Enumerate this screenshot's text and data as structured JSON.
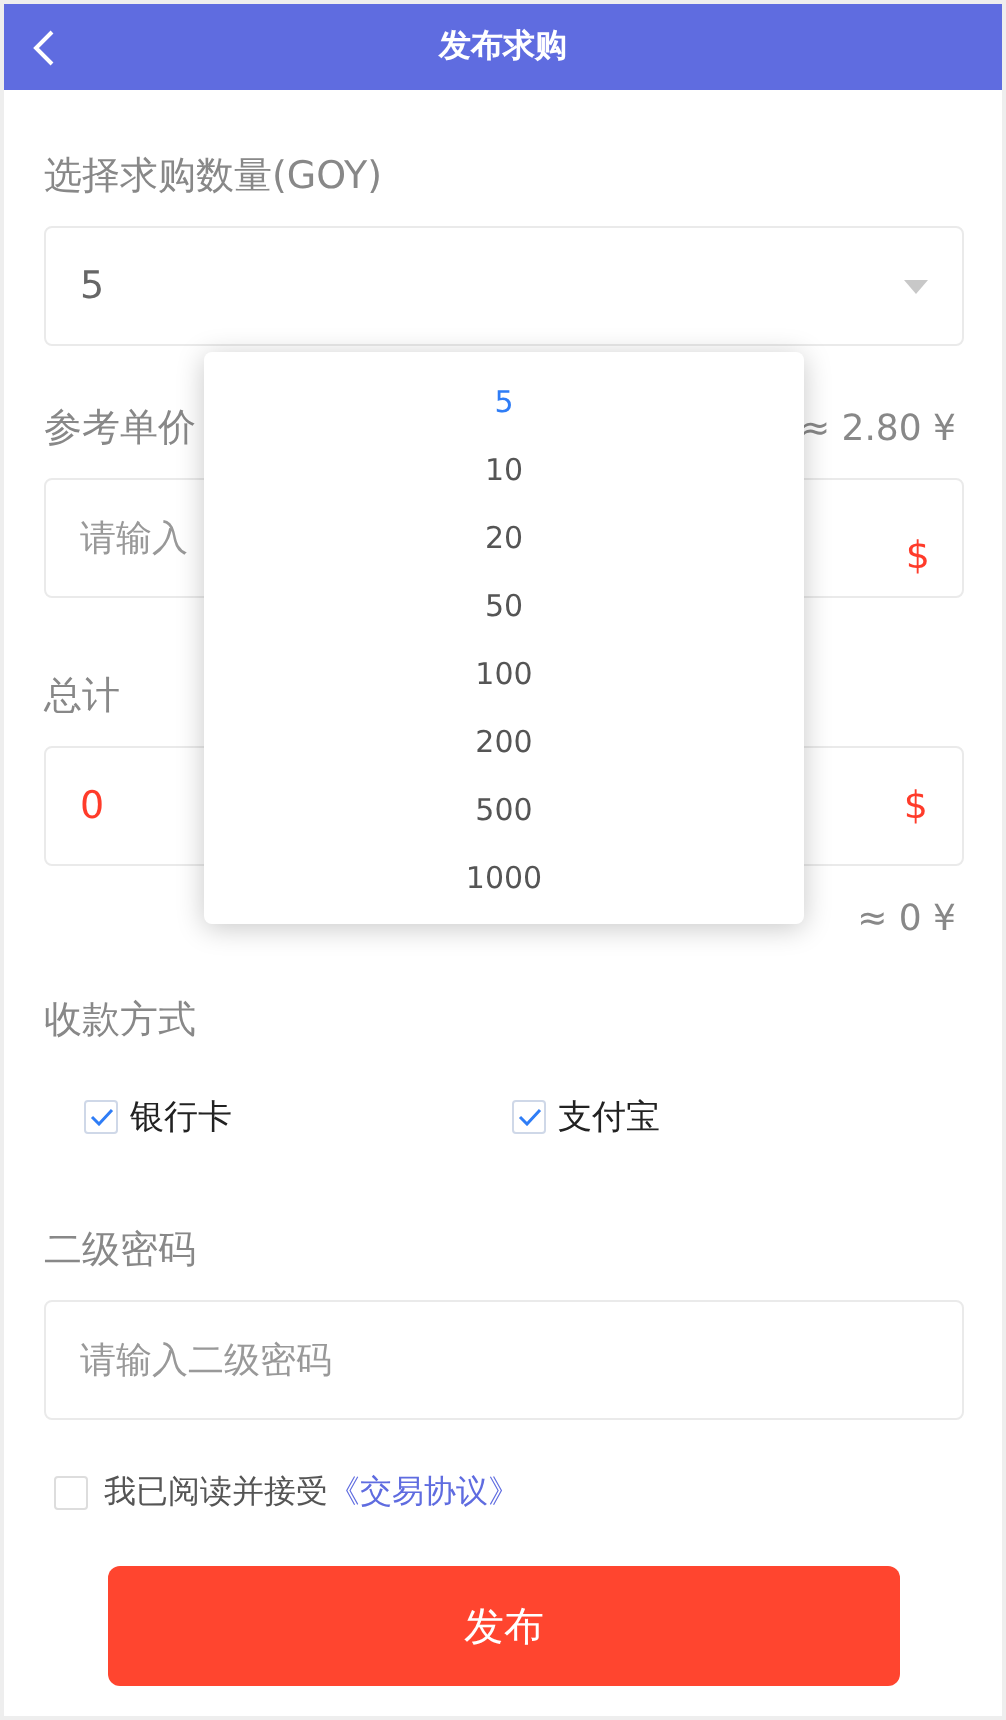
{
  "header": {
    "title": "发布求购"
  },
  "quantity": {
    "label": "选择求购数量(GOY)",
    "value": "5"
  },
  "price": {
    "label": "参考单价",
    "reading": "≈ 2.80 ¥",
    "placeholder": "请输入",
    "currency": "$"
  },
  "total": {
    "label": "总计",
    "value": "0",
    "currency": "$",
    "reading": "≈ 0 ¥"
  },
  "payment": {
    "label": "收款方式",
    "options": [
      {
        "label": "银行卡",
        "checked": true
      },
      {
        "label": "支付宝",
        "checked": true
      }
    ]
  },
  "password": {
    "label": "二级密码",
    "placeholder": "请输入二级密码"
  },
  "agreement": {
    "checked": false,
    "text": "我已阅读并接受",
    "link": "《交易协议》"
  },
  "submit": "发布",
  "dropdown": {
    "options": [
      {
        "label": "5",
        "selected": true
      },
      {
        "label": "10",
        "selected": false
      },
      {
        "label": "20",
        "selected": false
      },
      {
        "label": "50",
        "selected": false
      },
      {
        "label": "100",
        "selected": false
      },
      {
        "label": "200",
        "selected": false
      },
      {
        "label": "500",
        "selected": false
      },
      {
        "label": "1000",
        "selected": false
      }
    ]
  }
}
